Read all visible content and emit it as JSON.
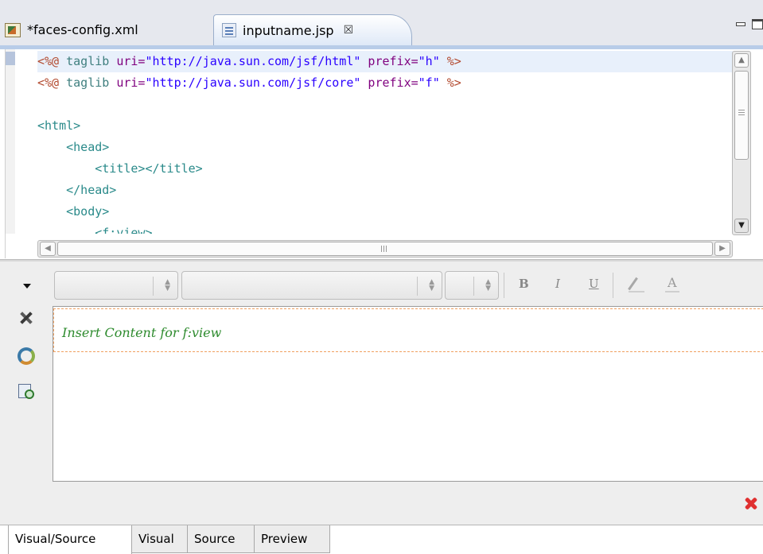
{
  "editor_tabs": [
    {
      "label": "*faces-config.xml",
      "icon": "xml-file-icon",
      "active": false
    },
    {
      "label": "inputname.jsp",
      "icon": "jsp-file-icon",
      "active": true,
      "close_glyph": "☒"
    }
  ],
  "source": {
    "lines": [
      [
        {
          "t": "<%@",
          "c": "dir"
        },
        {
          "t": " taglib ",
          "c": "kw"
        },
        {
          "t": "uri=",
          "c": "attr"
        },
        {
          "t": "\"http://java.sun.com/jsf/html\"",
          "c": "val"
        },
        {
          "t": " prefix=",
          "c": "attr"
        },
        {
          "t": "\"h\"",
          "c": "val"
        },
        {
          "t": " %>",
          "c": "dir"
        }
      ],
      [
        {
          "t": "<%@",
          "c": "dir"
        },
        {
          "t": " taglib ",
          "c": "kw"
        },
        {
          "t": "uri=",
          "c": "attr"
        },
        {
          "t": "\"http://java.sun.com/jsf/core\"",
          "c": "val"
        },
        {
          "t": " prefix=",
          "c": "attr"
        },
        {
          "t": "\"f\"",
          "c": "val"
        },
        {
          "t": " %>",
          "c": "dir"
        }
      ],
      [],
      [
        {
          "t": "<html>",
          "c": "tag"
        }
      ],
      [
        {
          "t": "    <head>",
          "c": "tag"
        }
      ],
      [
        {
          "t": "        <title></title>",
          "c": "tag"
        }
      ],
      [
        {
          "t": "    </head>",
          "c": "tag"
        }
      ],
      [
        {
          "t": "    <body>",
          "c": "tag"
        }
      ],
      [
        {
          "t": "        <f:view>",
          "c": "tag"
        }
      ]
    ]
  },
  "toolbar": {
    "style_value": "",
    "font_value": "",
    "size_value": "",
    "bold_label": "B",
    "italic_label": "I",
    "underline_label": "U",
    "font_color_glyph": "A"
  },
  "visual": {
    "placeholder": "Insert Content for f:view"
  },
  "mode_tabs": {
    "visual_source": "Visual/Source",
    "visual": "Visual",
    "source": "Source",
    "preview": "Preview"
  },
  "colors": {
    "directive": "#b34a2f",
    "keyword": "#3f7f7f",
    "attribute": "#7f007f",
    "value": "#2a00ff",
    "tag": "#2a8a8a",
    "placeholder_green": "#2e8b2e",
    "error_red": "#e03030"
  }
}
